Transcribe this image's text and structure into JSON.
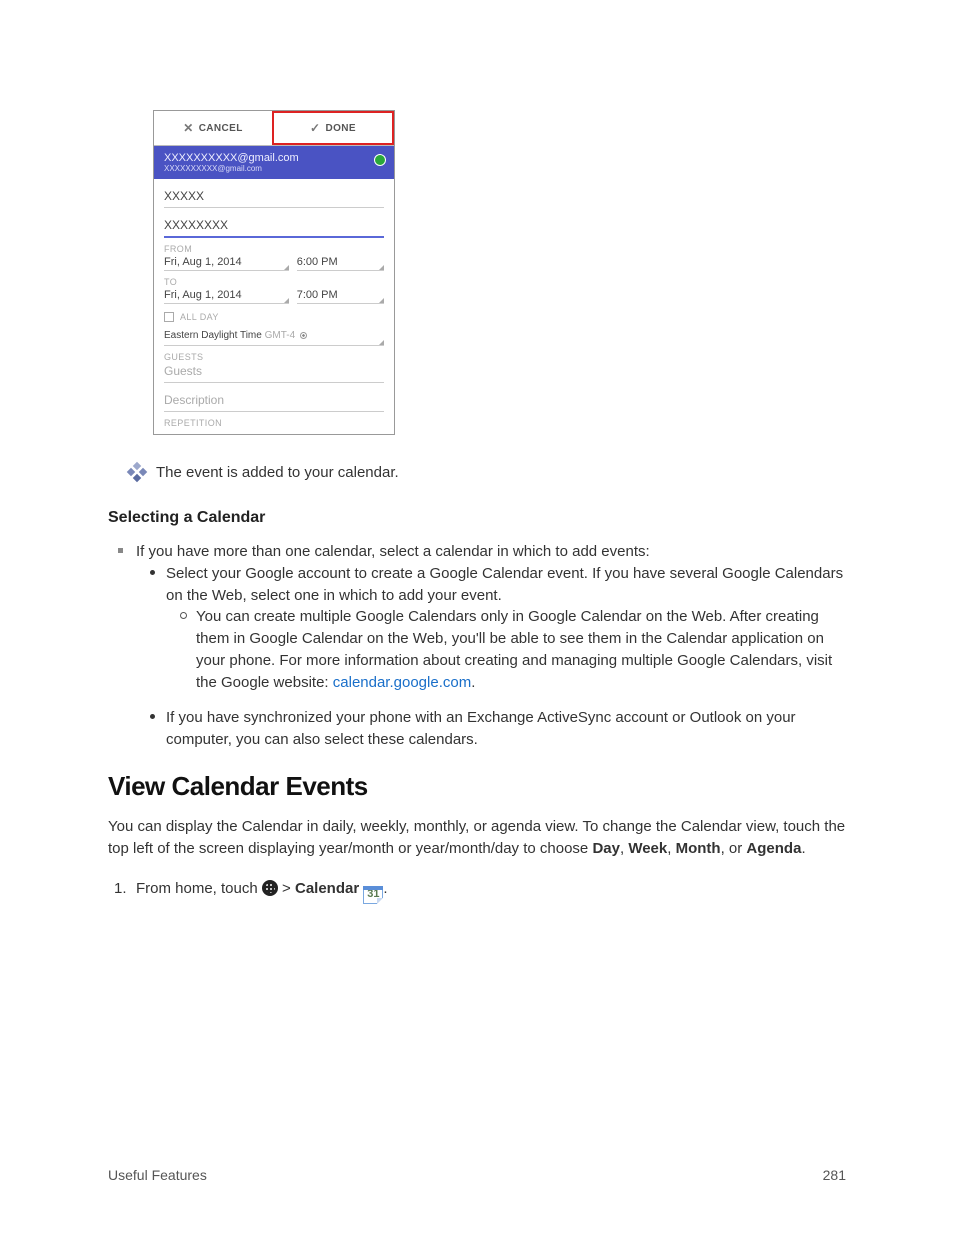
{
  "mockup": {
    "cancel": "CANCEL",
    "done": "DONE",
    "account_line1": "XXXXXXXXXX@gmail.com",
    "account_line2": "XXXXXXXXXX@gmail.com",
    "title_field": "XXXXX",
    "location_field": "XXXXXXXX",
    "from_label": "FROM",
    "from_date": "Fri, Aug 1, 2014",
    "from_time": "6:00 PM",
    "to_label": "TO",
    "to_date": "Fri, Aug 1, 2014",
    "to_time": "7:00 PM",
    "allday": "ALL DAY",
    "tz_name": "Eastern Daylight Time",
    "tz_gmt": "GMT-4",
    "guests_label": "GUESTS",
    "guests_placeholder": "Guests",
    "description_placeholder": "Description",
    "repetition_label": "REPETITION"
  },
  "result_text": "The event is added to your calendar.",
  "heading_select": "Selecting a Calendar",
  "select_intro": "If you have more than one calendar, select a calendar in which to add events:",
  "bullets": {
    "google_pre": "Select your Google account to create a Google Calendar event. If you have several Google Calendars on the Web, select one in which to add your event.",
    "google_sub_pre": "You can create multiple Google Calendars only in Google Calendar on the Web. After creating them in Google Calendar on the Web, you'll be able to see them in the Calendar application on your phone. For more information about creating and managing multiple Google Calendars, visit the Google website: ",
    "google_link": "calendar.google.com",
    "google_sub_post": ".",
    "exchange": "If you have synchronized your phone with an Exchange ActiveSync account or Outlook on your computer, you can also select these calendars."
  },
  "heading_view": "View Calendar Events",
  "view_para": {
    "p1": "You can display the Calendar in daily, weekly, monthly, or agenda view. To change the Calendar view, touch the top left of the screen displaying year/month or year/month/day to choose ",
    "day": "Day",
    "c1": ", ",
    "week": "Week",
    "c2": ", ",
    "month": "Month",
    "c3": ", or ",
    "agenda": "Agenda",
    "p2": "."
  },
  "step1": {
    "num": "1.",
    "pre": "From home, touch ",
    "gt": " > ",
    "calendar": "Calendar",
    "icon_num": "31",
    "post": "."
  },
  "footer_left": "Useful Features",
  "footer_right": "281"
}
